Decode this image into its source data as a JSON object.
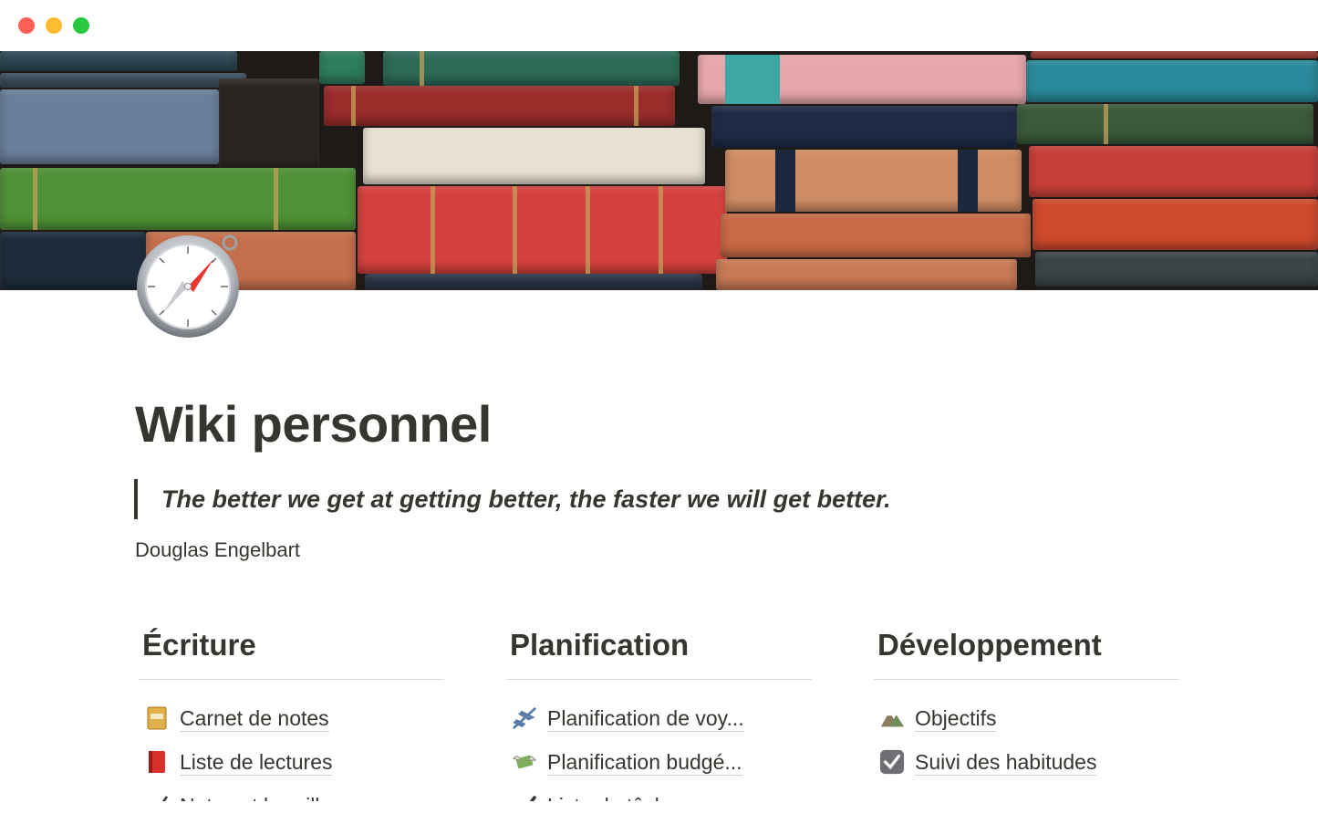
{
  "window": {
    "controls": [
      "close",
      "minimize",
      "zoom"
    ]
  },
  "cover": {
    "description_icon": "books-cover-image"
  },
  "page": {
    "icon": "compass-icon",
    "title": "Wiki personnel",
    "quote": "The better we get at getting better, the faster we will get better.",
    "author": "Douglas Engelbart"
  },
  "columns": [
    {
      "heading": "Écriture",
      "links": [
        {
          "emoji": "notebook-icon",
          "label": "Carnet de notes"
        },
        {
          "emoji": "red-book-icon",
          "label": "Liste de lectures"
        },
        {
          "emoji": "writing-hand-icon",
          "label": "Notes et brouillons"
        }
      ]
    },
    {
      "heading": "Planification",
      "links": [
        {
          "emoji": "airplane-icon",
          "label": "Planification de voy..."
        },
        {
          "emoji": "money-wings-icon",
          "label": "Planification budgé..."
        },
        {
          "emoji": "check-mark-icon",
          "label": "Liste de tâches"
        }
      ]
    },
    {
      "heading": "Développement",
      "links": [
        {
          "emoji": "mountain-icon",
          "label": "Objectifs"
        },
        {
          "emoji": "checkbox-icon",
          "label": "Suivi des habitudes"
        }
      ]
    }
  ],
  "colors": {
    "text": "#37352f",
    "divider": "#d9d9d6",
    "close": "#ff5f57",
    "minimize": "#febc2e",
    "zoom": "#28c840"
  }
}
